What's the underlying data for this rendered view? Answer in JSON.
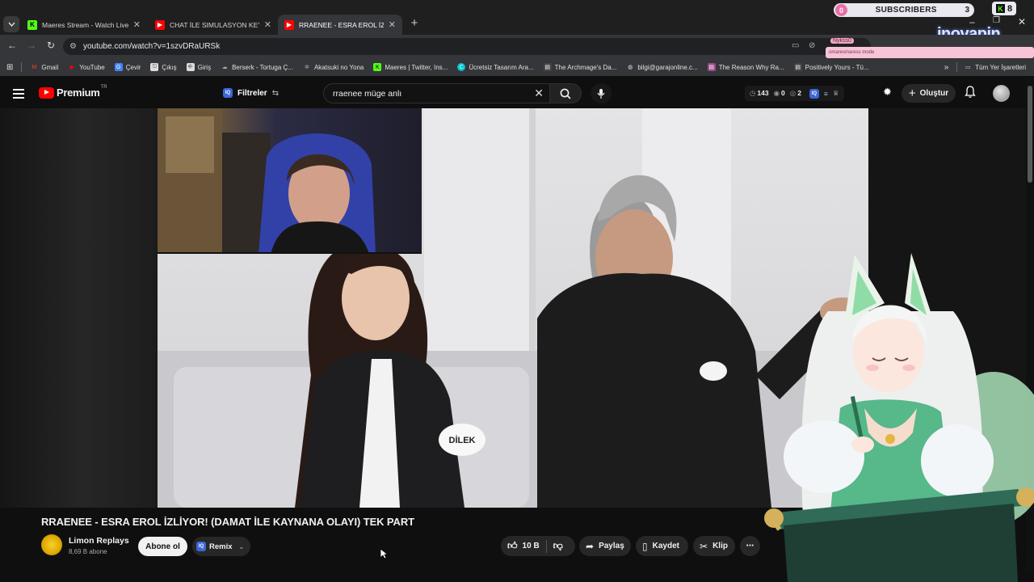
{
  "tabs": [
    {
      "title": "Maeres Stream - Watch Live on",
      "favicon": "kick-icon",
      "fav_color": "#53fc18"
    },
    {
      "title": "CHAT İLE SIMULASYON KEYFİ | ...",
      "favicon": "youtube-icon",
      "fav_color": "#ff0000"
    },
    {
      "title": "RRAENEE - ESRA EROL İZLİYOR! ...",
      "favicon": "youtube-icon",
      "fav_color": "#ff0000",
      "active": true
    }
  ],
  "overlay": {
    "subscribers_label": "SUBSCRIBERS",
    "subscribers_left": "0",
    "subscribers_count": "3",
    "kick_count": "8",
    "sponsor": "inovapin",
    "ticker_user": "Nykss0",
    "ticker_text": "omaresmaress mode"
  },
  "address_bar": {
    "url": "youtube.com/watch?v=1szvDRaURSk"
  },
  "bookmarks": [
    {
      "label": "Gmail",
      "icon": "gmail-icon",
      "color": "#ea4335"
    },
    {
      "label": "YouTube",
      "icon": "youtube-icon",
      "color": "#ff0000"
    },
    {
      "label": "Çevir",
      "icon": "translate-icon",
      "color": "#4285f4"
    },
    {
      "label": "Çıkış",
      "icon": "exit-icon",
      "color": "#dddddd"
    },
    {
      "label": "Giriş",
      "icon": "login-icon",
      "color": "#dddddd"
    },
    {
      "label": "Berserk - Tortuga Ç...",
      "icon": "link-icon",
      "color": "#999999"
    },
    {
      "label": "Akatsuki no Yona",
      "icon": "link-icon",
      "color": "#999999"
    },
    {
      "label": "Maeres | Twitter, Ins...",
      "icon": "kick-icon",
      "color": "#53fc18"
    },
    {
      "label": "Ücretsiz Tasarım Ara...",
      "icon": "canva-icon",
      "color": "#00c4cc"
    },
    {
      "label": "The Archmage's Da...",
      "icon": "book-icon",
      "color": "#444444"
    },
    {
      "label": "bilgi@garajonline.c...",
      "icon": "globe-icon",
      "color": "#dddddd"
    },
    {
      "label": "The Reason Why Ra...",
      "icon": "book-icon",
      "color": "#9c4a8a"
    },
    {
      "label": "Positively Yours - Tü...",
      "icon": "book-icon",
      "color": "#444444"
    }
  ],
  "bookmarks_all": "Tüm Yer İşaretleri",
  "youtube": {
    "logo_text": "Premium",
    "country": "TR",
    "filters_label": "Filtreler",
    "iq_badge": "IQ",
    "search_value": "rraenee müge anlı",
    "stats": {
      "views": "143",
      "b": "0",
      "c": "2"
    },
    "create_label": "Oluştur"
  },
  "video": {
    "title": "RRAENEE - ESRA EROL İZLİYOR! (DAMAT İLE KAYNANA OLAYI) TEK PART",
    "name_tag": "DİLEK",
    "channel_name": "Limon Replays",
    "channel_subs": "8,69 B abone",
    "subscribe_label": "Abone ol",
    "remix_label": "Remix",
    "likes": "10 B",
    "share_label": "Paylaş",
    "save_label": "Kaydet",
    "clip_label": "Klip"
  }
}
